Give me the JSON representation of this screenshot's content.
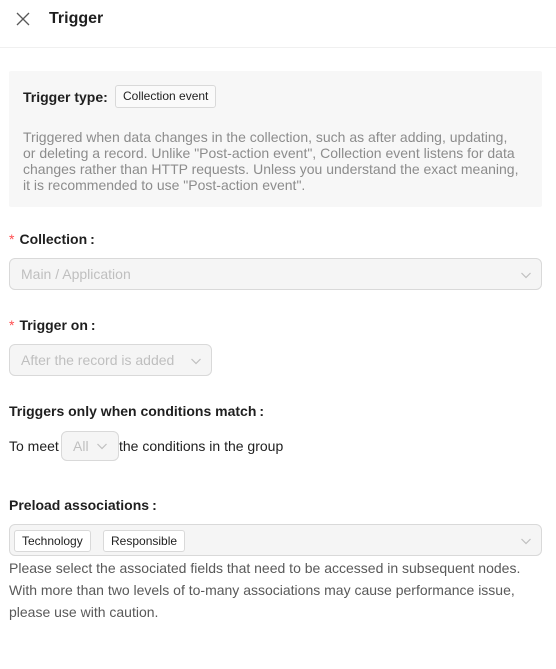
{
  "header": {
    "title": "Trigger",
    "close_icon": "close-icon"
  },
  "trigger_type": {
    "label": "Trigger type:",
    "value": "Collection event",
    "description": "Triggered when data changes in the collection, such as after adding, updating, or deleting a record. Unlike \"Post-action event\", Collection event listens for data changes rather than HTTP requests. Unless you understand the exact meaning, it is recommended to use \"Post-action event\"."
  },
  "collection": {
    "required_mark": "*",
    "label": "Collection",
    "colon": ":",
    "value": "Main / Application"
  },
  "trigger_on": {
    "required_mark": "*",
    "label": "Trigger on",
    "colon": ":",
    "value": "After the record is added"
  },
  "conditions": {
    "label": "Triggers only when conditions match",
    "colon": ":",
    "prefix": "To meet",
    "mode": "All",
    "suffix": "the conditions in the group"
  },
  "preload": {
    "label": "Preload associations",
    "colon": ":",
    "selected": [
      "Technology",
      "Responsible"
    ],
    "help": "Please select the associated fields that need to be accessed in subsequent nodes. With more than two levels of to-many associations may cause performance issue, please use with caution."
  },
  "colors": {
    "required": "#ff4d4f",
    "disabled_text": "#bfbfbf",
    "card_background": "#f7f7f7"
  }
}
